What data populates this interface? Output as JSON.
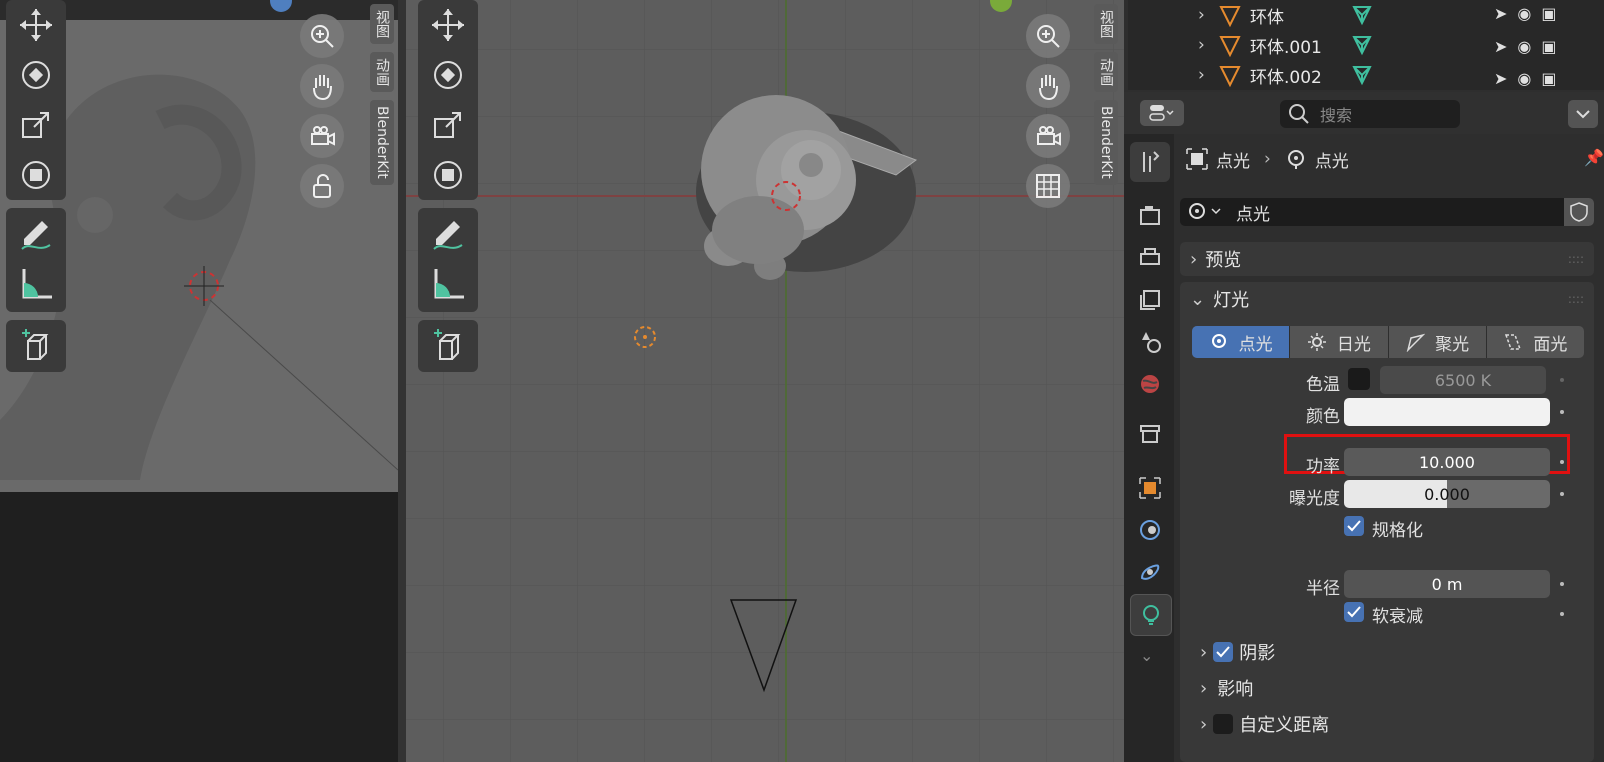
{
  "left_viewport": {
    "tabs": [
      "视图",
      "动画",
      "BlenderKit"
    ]
  },
  "mid_viewport": {
    "tabs": [
      "视图",
      "动画",
      "BlenderKit"
    ]
  },
  "outliner": {
    "rows": [
      {
        "name": "环体"
      },
      {
        "name": "环体.001"
      },
      {
        "name": "环体.002"
      }
    ]
  },
  "properties": {
    "search_placeholder": "搜索",
    "breadcrumb": {
      "object": "点光",
      "data": "点光"
    },
    "datablock_name": "点光",
    "sections": {
      "preview": "预览",
      "light": "灯光",
      "shadow": "阴影",
      "influence": "影响",
      "custom_distance": "自定义距离"
    },
    "light_types": [
      "点光",
      "日光",
      "聚光",
      "面光"
    ],
    "fields": {
      "temperature_label": "色温",
      "temperature_value": "6500 K",
      "color_label": "颜色",
      "power_label": "功率",
      "power_value": "10.000",
      "exposure_label": "曝光度",
      "exposure_value": "0.000",
      "normalize_label": "规格化",
      "radius_label": "半径",
      "radius_value": "0 m",
      "soft_falloff_label": "软衰减"
    },
    "highlight_color": "#e01010",
    "accent_color": "#4772b3"
  }
}
